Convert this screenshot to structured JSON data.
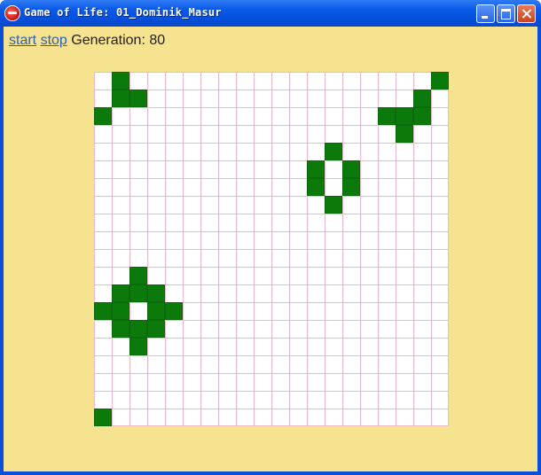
{
  "window": {
    "title": "Game of Life: 01_Dominik_Masur",
    "buttons": [
      "minimize",
      "maximize",
      "close"
    ]
  },
  "controls": {
    "start_label": "start",
    "stop_label": "stop",
    "generation_label": "Generation:",
    "generation_value": "80"
  },
  "board": {
    "columns": 20,
    "rows": 20,
    "cell_color": "#0b7a0b",
    "background_color": "#ffffff",
    "grid_line_color": "#f0b8c6",
    "live_cells": [
      [
        1,
        0
      ],
      [
        19,
        0
      ],
      [
        1,
        1
      ],
      [
        2,
        1
      ],
      [
        18,
        1
      ],
      [
        0,
        2
      ],
      [
        16,
        2
      ],
      [
        17,
        2
      ],
      [
        18,
        2
      ],
      [
        17,
        3
      ],
      [
        13,
        4
      ],
      [
        12,
        5
      ],
      [
        14,
        5
      ],
      [
        12,
        6
      ],
      [
        14,
        6
      ],
      [
        13,
        7
      ],
      [
        2,
        11
      ],
      [
        1,
        12
      ],
      [
        2,
        12
      ],
      [
        3,
        12
      ],
      [
        0,
        13
      ],
      [
        1,
        13
      ],
      [
        3,
        13
      ],
      [
        4,
        13
      ],
      [
        1,
        14
      ],
      [
        2,
        14
      ],
      [
        3,
        14
      ],
      [
        2,
        15
      ],
      [
        0,
        19
      ]
    ]
  },
  "colors": {
    "client_background": "#f5e38f",
    "title_bar": "#0b5ae8",
    "link": "#2b5fb8"
  }
}
